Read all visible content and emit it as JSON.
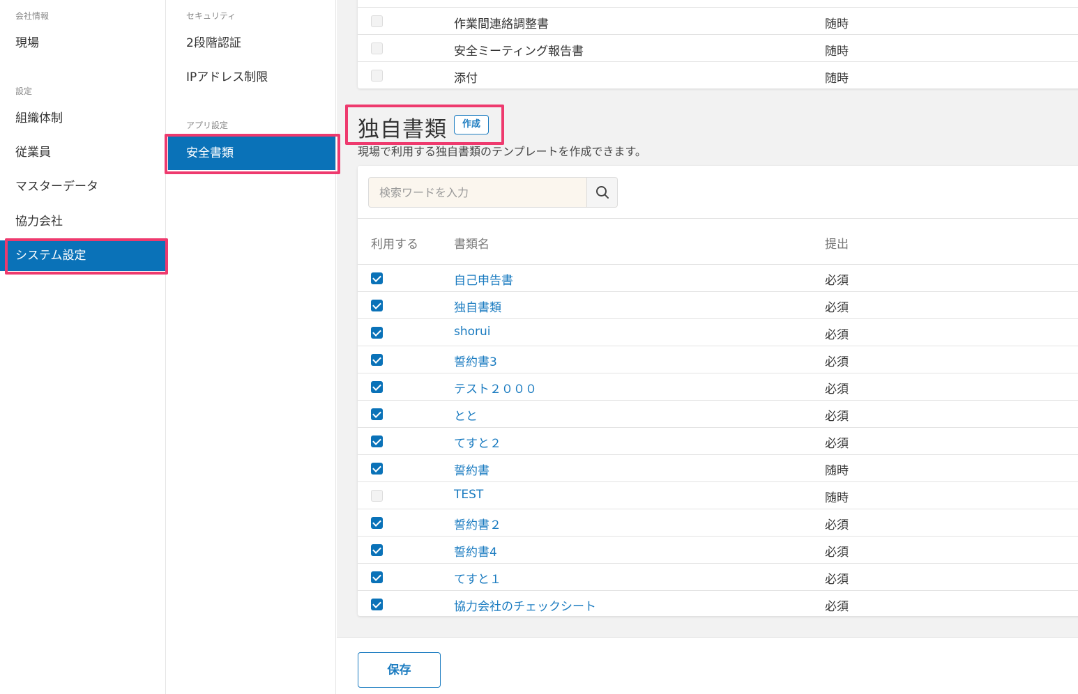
{
  "sidebar": {
    "section_company": "会社情報",
    "item_site": "現場",
    "section_settings": "設定",
    "items": [
      {
        "label": "組織体制"
      },
      {
        "label": "従業員"
      },
      {
        "label": "マスターデータ"
      },
      {
        "label": "協力会社"
      },
      {
        "label": "システム設定"
      }
    ]
  },
  "subnav": {
    "section_security": "セキュリティ",
    "two_factor": "2段階認証",
    "ip_restriction": "IPアドレス制限",
    "section_app": "アプリ設定",
    "safety_docs": "安全書類"
  },
  "top_table": {
    "rows": [
      {
        "name": "作業間連絡調整書",
        "submission": "随時",
        "checked": false
      },
      {
        "name": "安全ミーティング報告書",
        "submission": "随時",
        "checked": false
      },
      {
        "name": "添付",
        "submission": "随時",
        "checked": false
      }
    ]
  },
  "custom_docs": {
    "title": "独自書類",
    "create_label": "作成",
    "description": "現場で利用する独自書類のテンプレートを作成できます。",
    "search_placeholder": "検索ワードを入力",
    "headers": {
      "use": "利用する",
      "name": "書類名",
      "submission": "提出"
    },
    "rows": [
      {
        "name": "自己申告書",
        "submission": "必須",
        "checked": true
      },
      {
        "name": "独自書類",
        "submission": "必須",
        "checked": true
      },
      {
        "name": "shorui",
        "submission": "必須",
        "checked": true
      },
      {
        "name": "誓約書3",
        "submission": "必須",
        "checked": true
      },
      {
        "name": "テスト２０００",
        "submission": "必須",
        "checked": true
      },
      {
        "name": "とと",
        "submission": "必須",
        "checked": true
      },
      {
        "name": "てすと２",
        "submission": "必須",
        "checked": true
      },
      {
        "name": "誓約書",
        "submission": "随時",
        "checked": true
      },
      {
        "name": "TEST",
        "submission": "随時",
        "checked": false
      },
      {
        "name": "誓約書２",
        "submission": "必須",
        "checked": true
      },
      {
        "name": "誓約書4",
        "submission": "必須",
        "checked": true
      },
      {
        "name": "てすと１",
        "submission": "必須",
        "checked": true
      },
      {
        "name": "協力会社のチェックシート",
        "submission": "必須",
        "checked": true
      }
    ]
  },
  "footer": {
    "save_label": "保存"
  },
  "colors": {
    "accent": "#0a72b8",
    "highlight": "#ee3a6e",
    "link": "#1a7bc0"
  }
}
